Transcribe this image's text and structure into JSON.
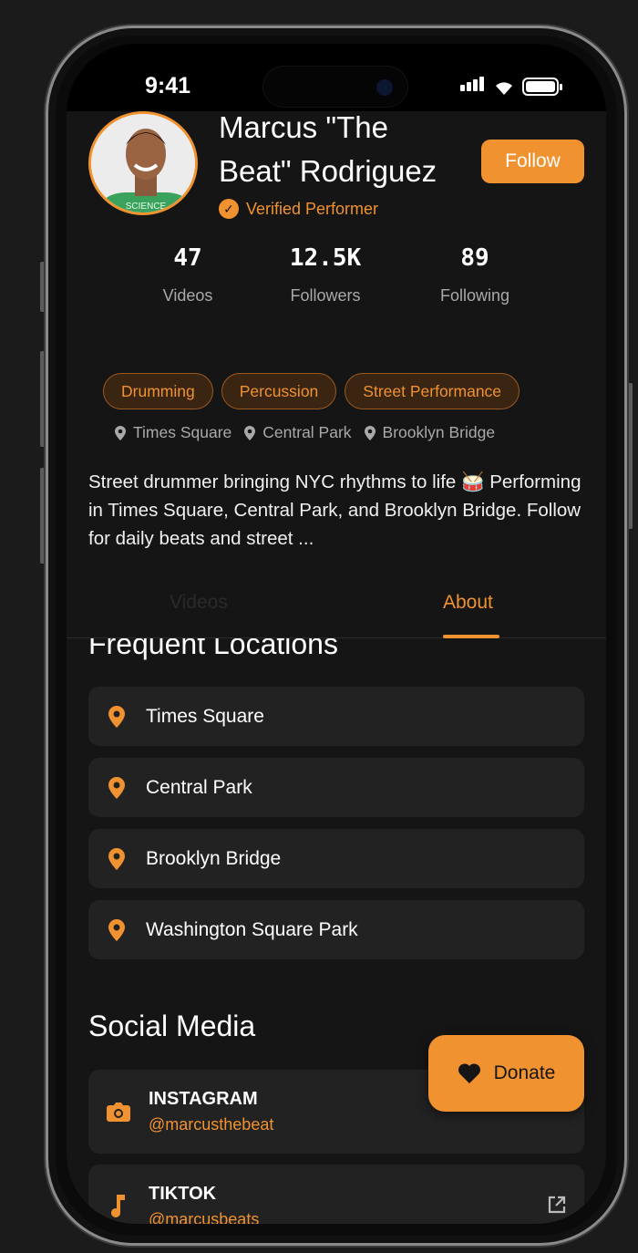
{
  "status": {
    "time": "9:41"
  },
  "profile": {
    "name": "Marcus \"The Beat\" Rodriguez",
    "verified_label": "Verified Performer",
    "follow_label": "Follow",
    "avatar_shirt_text": "SCIENCE"
  },
  "stats": [
    {
      "value": "47",
      "label": "Videos"
    },
    {
      "value": "12.5K",
      "label": "Followers"
    },
    {
      "value": "89",
      "label": "Following"
    }
  ],
  "tags": [
    "Drumming",
    "Percussion",
    "Street Performance"
  ],
  "header_locations": [
    "Times Square",
    "Central Park",
    "Brooklyn Bridge"
  ],
  "bio": "Street drummer bringing NYC rhythms to life 🥁 Performing in Times Square, Central Park, and Brooklyn Bridge. Follow for daily beats and street ...",
  "tabs": {
    "videos": "Videos",
    "about": "About",
    "active": "About"
  },
  "frequent_locations": {
    "title": "Frequent Locations",
    "items": [
      "Times Square",
      "Central Park",
      "Brooklyn Bridge",
      "Washington Square Park"
    ]
  },
  "social_media": {
    "title": "Social Media",
    "items": [
      {
        "platform": "INSTAGRAM",
        "handle": "@marcusthebeat",
        "icon": "camera-icon"
      },
      {
        "platform": "TIKTOK",
        "handle": "@marcusbeats",
        "icon": "music-note-icon"
      }
    ]
  },
  "donate_label": "Donate",
  "colors": {
    "accent": "#f0922f",
    "background": "#151515",
    "card": "#222222"
  }
}
